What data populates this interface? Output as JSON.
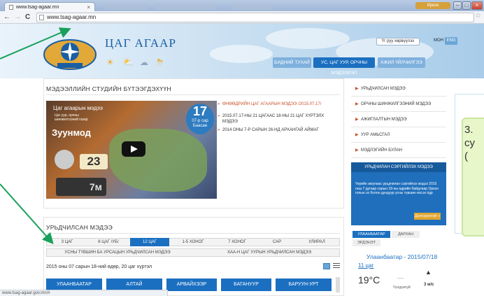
{
  "browser": {
    "tab_title": "www.tsag-agaar.mn",
    "tab_close": "×",
    "url": "www.tsag-agaar.mn",
    "back_icon": "←",
    "forward_icon": "→",
    "reload_icon": "C",
    "bookmark_icon": "☆",
    "user_label": "Ириэх",
    "status_url": "www.tsag-agaar.gov.mn/#"
  },
  "site": {
    "brand": "ЦАГ АГААР",
    "lang_button": "Үг руу хөрвүүлэх",
    "lang_mon": "МОН",
    "lang_eng": "ENG",
    "nav": [
      "БИДНИЙ ТУХАЙ",
      "УС, ЦАГ УУР, ОРЧНЫ МЭДЭЭЛЭЛ",
      "АЖИЛ ҮЙЛЧИЛГЭЭ"
    ]
  },
  "studio": {
    "title": "МЭДЭЭЛЛИЙН СТУДИЙН БҮТЭЭГДЭХҮҮН",
    "video": {
      "title": "Цаг агаарын мэдээ",
      "subtitle_1": "Цаг уур, орчны",
      "subtitle_2": "шинжилгээний газар",
      "city": "Зуунмод",
      "temp": "23",
      "date_day": "17",
      "date_month": "07-р сар",
      "date_weekday": "Баасан",
      "wind": "7м"
    },
    "news": [
      "ӨНӨӨДРИЙН ЦАГ АГААРЫН МЭДЭЭ /2015.07.17/",
      "2015.07.17-НЫ 21 ЦАГААС 18-НЫ 21 ЦАГ ХҮРТЭЛХ МЭДЭЭ",
      "2014 ОНЫ 7-Р САРЫН 26-НД АРХАНГАЙ АЙМАГ"
    ]
  },
  "forecast": {
    "title": "УРЬДЧИЛСАН МЭДЭЭ",
    "filters": [
      "3 ЦАГ",
      "6 ЦАГ /УБ/",
      "12 ЦАГ",
      "1-5 ХОНОГ",
      "7 ХОНОГ",
      "САР",
      "УЛИРАЛ"
    ],
    "active_filter": "12 ЦАГ",
    "subfilters": [
      "УСНЫ ТҮВШИН БА УРСАЦЫН УРЬДЧИЛСАН МЭДЭЭ",
      "ХАА-Н ЦАГ УУРЫН УРЬДЧИЛСАН МЭДЭЭ"
    ],
    "date_text": "2015 оны 07 сарын 18-ний өдөр, 20 цаг хүртэл",
    "cities": [
      "УЛААНБААТАР",
      "АЛТАЙ",
      "АРВАЙХЭЭР",
      "БАГАНУУР",
      "БАРУУН-УРТ"
    ]
  },
  "sidebar": {
    "items": [
      "УРЬДЧИЛСАН МЭДЭЭ",
      "ОРЧНЫ ШИНЖИЛГЭЭНИЙ МЭДЭЭ",
      "АЖИГЛАЛТЫН МЭДЭЭ",
      "УУР АМЬСГАЛ",
      "МЭДЛЭГИЙН БУЛАН"
    ],
    "notice_title": "УРЬДЧИЛАН СЭРГИЙЛЭХ МЭДЭЭ",
    "notice_body": "Үерийн аюулаас урьдчилан сэргийлэх мэдээ 2015 оны 7 дугаар сарын 18-ны өдрийн байдлаар Орхон голын эх болон дундуур усны түвшин ихсэх ёдр",
    "notice_more": "Дэлгэрэнгүй »",
    "weather_tabs": [
      "УЛААНБААТАР",
      "ДАРХАН",
      "ЭРДЭНЭТ"
    ],
    "weather_city_date": "Улаанбаатар - 2015/07/18",
    "weather_link": "11 цаг",
    "weather_temp": "19°C",
    "weather_dash": "—",
    "weather_cond": "Үзэгдэлгүй",
    "weather_wind": "3 м/с"
  },
  "slide": {
    "text_1": "3.",
    "text_2": "су",
    "text_3": "("
  },
  "colors": {
    "accent": "#1b6fc0",
    "orange": "#c8512c",
    "arrow_green": "#17a05a"
  }
}
